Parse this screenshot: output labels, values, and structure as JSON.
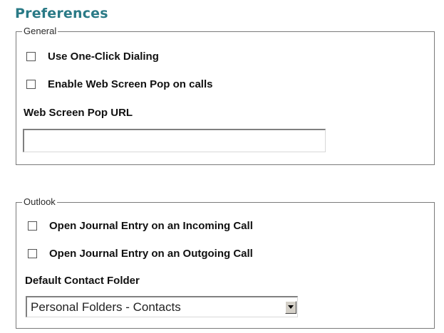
{
  "page": {
    "title": "Preferences"
  },
  "general": {
    "legend": "General",
    "one_click_dialing": {
      "label": "Use One-Click Dialing",
      "checked": false
    },
    "web_screen_pop": {
      "label": "Enable Web Screen Pop on calls",
      "checked": false
    },
    "url_label": "Web Screen Pop URL",
    "url_value": ""
  },
  "outlook": {
    "legend": "Outlook",
    "journal_incoming": {
      "label": "Open Journal Entry on an Incoming Call",
      "checked": false
    },
    "journal_outgoing": {
      "label": "Open Journal Entry on an Outgoing Call",
      "checked": false
    },
    "folder_label": "Default Contact Folder",
    "folder_selected": "Personal Folders - Contacts"
  },
  "icons": {
    "dropdown_arrow": "chevron-down-icon"
  },
  "colors": {
    "title": "#2a7a86",
    "border": "#7a7a7a"
  }
}
